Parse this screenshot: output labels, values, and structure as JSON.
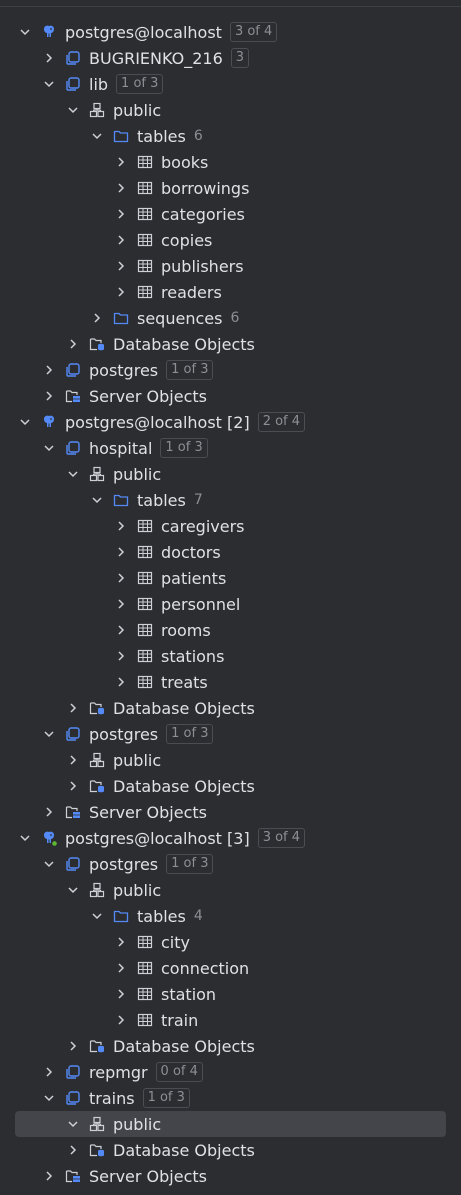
{
  "colors": {
    "background": "#2b2d30",
    "text": "#dfe1e5",
    "muted": "#8c8f94",
    "selection": "#43454a",
    "icon_blue": "#548af7",
    "icon_gray": "#ced0d6",
    "status_green": "#5fb832"
  },
  "tree": {
    "r1": {
      "label": "postgres@localhost",
      "badge": "3 of 4",
      "icon": "postgres-elephant-icon"
    },
    "r2": {
      "label": "BUGRIENKO_216",
      "badge": "3",
      "icon": "database-icon"
    },
    "r3": {
      "label": "lib",
      "badge": "1 of 3",
      "icon": "database-icon"
    },
    "r4": {
      "label": "public",
      "icon": "schema-icon"
    },
    "r5": {
      "label": "tables",
      "count": "6",
      "icon": "folder-icon"
    },
    "r6": {
      "label": "books",
      "icon": "table-icon"
    },
    "r7": {
      "label": "borrowings",
      "icon": "table-icon"
    },
    "r8": {
      "label": "categories",
      "icon": "table-icon"
    },
    "r9": {
      "label": "copies",
      "icon": "table-icon"
    },
    "r10": {
      "label": "publishers",
      "icon": "table-icon"
    },
    "r11": {
      "label": "readers",
      "icon": "table-icon"
    },
    "r12": {
      "label": "sequences",
      "count": "6",
      "icon": "folder-icon"
    },
    "r13": {
      "label": "Database Objects",
      "icon": "database-objects-icon"
    },
    "r14": {
      "label": "postgres",
      "badge": "1 of 3",
      "icon": "database-icon"
    },
    "r15": {
      "label": "Server Objects",
      "icon": "server-objects-icon"
    },
    "r16": {
      "label": "postgres@localhost [2]",
      "badge": "2 of 4",
      "icon": "postgres-elephant-icon"
    },
    "r17": {
      "label": "hospital",
      "badge": "1 of 3",
      "icon": "database-icon"
    },
    "r18": {
      "label": "public",
      "icon": "schema-icon"
    },
    "r19": {
      "label": "tables",
      "count": "7",
      "icon": "folder-icon"
    },
    "r20": {
      "label": "caregivers",
      "icon": "table-icon"
    },
    "r21": {
      "label": "doctors",
      "icon": "table-icon"
    },
    "r22": {
      "label": "patients",
      "icon": "table-icon"
    },
    "r23": {
      "label": "personnel",
      "icon": "table-icon"
    },
    "r24": {
      "label": "rooms",
      "icon": "table-icon"
    },
    "r25": {
      "label": "stations",
      "icon": "table-icon"
    },
    "r26": {
      "label": "treats",
      "icon": "table-icon"
    },
    "r27": {
      "label": "Database Objects",
      "icon": "database-objects-icon"
    },
    "r28": {
      "label": "postgres",
      "badge": "1 of 3",
      "icon": "database-icon"
    },
    "r29": {
      "label": "public",
      "icon": "schema-icon"
    },
    "r30": {
      "label": "Database Objects",
      "icon": "database-objects-icon"
    },
    "r31": {
      "label": "Server Objects",
      "icon": "server-objects-icon"
    },
    "r32": {
      "label": "postgres@localhost [3]",
      "badge": "3 of 4",
      "icon": "postgres-elephant-connected-icon"
    },
    "r33": {
      "label": "postgres",
      "badge": "1 of 3",
      "icon": "database-icon"
    },
    "r34": {
      "label": "public",
      "icon": "schema-icon"
    },
    "r35": {
      "label": "tables",
      "count": "4",
      "icon": "folder-icon"
    },
    "r36": {
      "label": "city",
      "icon": "table-icon"
    },
    "r37": {
      "label": "connection",
      "icon": "table-icon"
    },
    "r38": {
      "label": "station",
      "icon": "table-icon"
    },
    "r39": {
      "label": "train",
      "icon": "table-icon"
    },
    "r40": {
      "label": "Database Objects",
      "icon": "database-objects-icon"
    },
    "r41": {
      "label": "repmgr",
      "badge": "0 of 4",
      "icon": "database-icon"
    },
    "r42": {
      "label": "trains",
      "badge": "1 of 3",
      "icon": "database-icon"
    },
    "r43": {
      "label": "public",
      "icon": "schema-icon"
    },
    "r44": {
      "label": "Database Objects",
      "icon": "database-objects-icon"
    },
    "r45": {
      "label": "Server Objects",
      "icon": "server-objects-icon"
    }
  }
}
